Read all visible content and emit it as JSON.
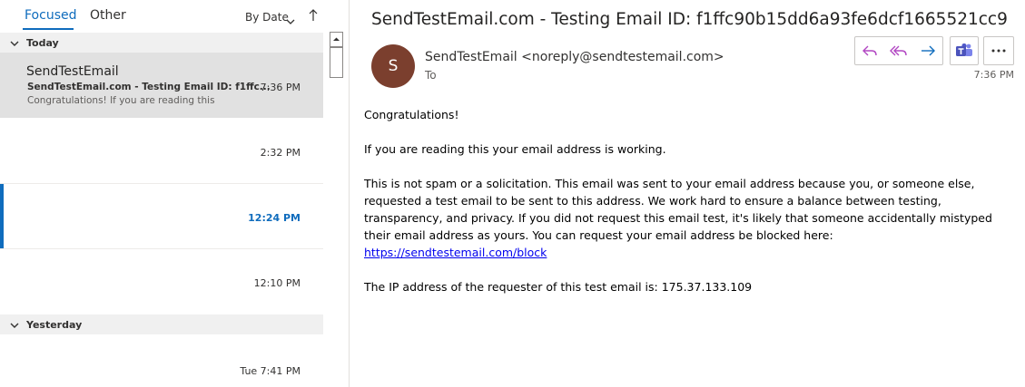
{
  "list": {
    "tabs": [
      {
        "label": "Focused"
      },
      {
        "label": "Other"
      }
    ],
    "sort_label": "By Date",
    "groups": [
      {
        "label": "Today"
      },
      {
        "label": "Yesterday"
      }
    ],
    "messages": [
      {
        "sender": "SendTestEmail",
        "subject": "SendTestEmail.com - Testing Email ID: f1ffc...",
        "preview": "Congratulations!  If you are reading this",
        "time": "7:36 PM"
      },
      {
        "sender": "",
        "subject": "",
        "preview": "",
        "time": "2:32 PM"
      },
      {
        "sender": "",
        "subject": "",
        "preview": "",
        "time": "12:24 PM",
        "unread": true
      },
      {
        "sender": "",
        "subject": "",
        "preview": "",
        "time": "12:10 PM"
      },
      {
        "sender": "",
        "subject": "",
        "preview": "",
        "time": "Tue 7:41 PM"
      }
    ]
  },
  "reading": {
    "subject": "SendTestEmail.com - Testing Email ID: f1ffc90b15dd6a93fe6dcf1665521cc9",
    "avatar_initial": "S",
    "avatar_color": "#7b3f2e",
    "from": "SendTestEmail <noreply@sendtestemail.com>",
    "to_label": "To",
    "time": "7:36 PM",
    "actions": {
      "reply_icon": "reply-icon",
      "reply_all_icon": "reply-all-icon",
      "forward_icon": "forward-icon",
      "teams_icon": "teams-icon",
      "more_icon": "more-icon"
    },
    "body": {
      "greeting": "Congratulations!",
      "p1": "If you are reading this your email address is working.",
      "p2": "This is not spam or a solicitation. This email was sent to your email address because you, or someone else, requested a test email to be sent to this address. We work hard to ensure a balance between testing, transparency, and privacy. If you did not request this email test, it's likely that someone accidentally mistyped their email address as yours. You can request your email address be blocked here: ",
      "link": "https://sendtestemail.com/block",
      "p3": "The IP address of the requester of this test email is: 175.37.133.109"
    }
  },
  "colors": {
    "accent": "#0f6cbd",
    "reply_icon": "#b146c2"
  }
}
